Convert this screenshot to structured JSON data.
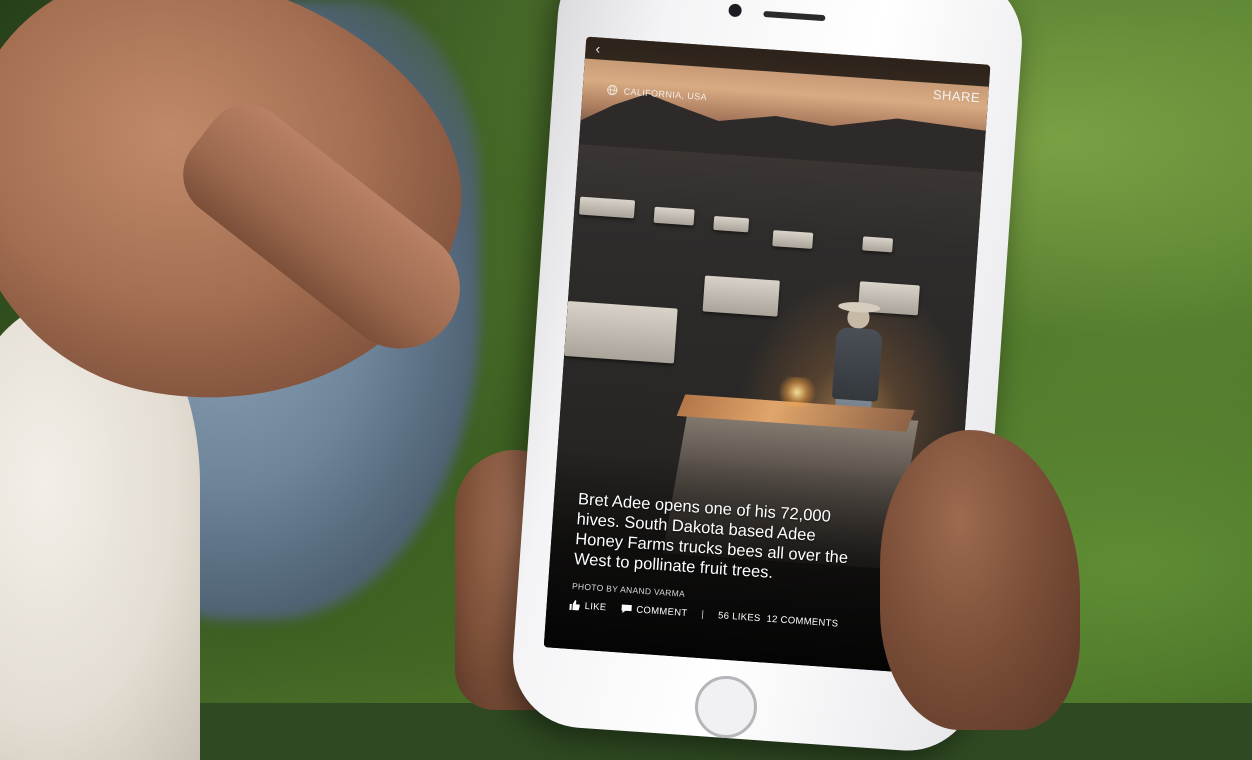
{
  "topbar": {
    "back_glyph": "‹",
    "share_label": "SHARE"
  },
  "location": {
    "icon": "globe-icon",
    "label": "CALIFORNIA, USA"
  },
  "post": {
    "caption": "Bret Adee opens one of his 72,000 hives. South Dakota based Adee Honey Farms trucks bees all over the West to pollinate fruit trees.",
    "credit": "PHOTO BY ANAND VARMA"
  },
  "actions": {
    "like_label": "LIKE",
    "like_icon": "thumbs-up-icon",
    "comment_label": "COMMENT",
    "comment_icon": "speech-bubble-icon",
    "separator": "|",
    "likes_count": "56 LIKES",
    "comments_count": "12 COMMENTS"
  }
}
